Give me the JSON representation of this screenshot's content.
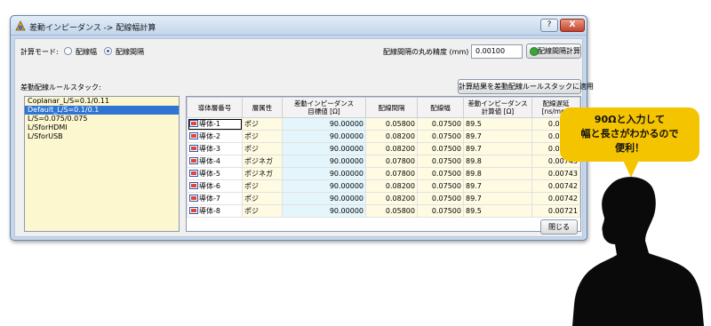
{
  "window": {
    "title": "差動インピーダンス -> 配線幅計算",
    "help_label": "?",
    "close_label": "X"
  },
  "mode": {
    "label": "計算モード:",
    "options": [
      "配線幅",
      "配線間隔"
    ],
    "selected": "配線間隔"
  },
  "precision": {
    "label": "配線間隔の丸め精度 (mm)",
    "value": "0.00100"
  },
  "buttons": {
    "calc": "配線間隔計算",
    "apply": "計算結果を差動配線ルールスタックに適用",
    "close": "閉じる"
  },
  "stack": {
    "label": "差動配線ルールスタック:",
    "items": [
      "Coplanar_L/S=0.1/0.11",
      "Default_L/S=0.1/0.1",
      "L/S=0.075/0.075",
      "L/SforHDMI",
      "L/SforUSB"
    ],
    "selected_index": 1
  },
  "table": {
    "headers": [
      "導体層番号",
      "層属性",
      "差動インピーダンス\n目標値 [Ω]",
      "配線間隔",
      "配線幅",
      "差動インピーダンス\n計算値 [Ω]",
      "配線遅延\n[ns/mm]"
    ],
    "rows": [
      [
        "導体-1",
        "ポジ",
        "90.00000",
        "0.05800",
        "0.07500",
        "89.5",
        "0.00721"
      ],
      [
        "導体-2",
        "ポジ",
        "90.00000",
        "0.08200",
        "0.07500",
        "89.7",
        "0.00742"
      ],
      [
        "導体-3",
        "ポジ",
        "90.00000",
        "0.08200",
        "0.07500",
        "89.7",
        "0.00742"
      ],
      [
        "導体-4",
        "ポジネガ",
        "90.00000",
        "0.07800",
        "0.07500",
        "89.8",
        "0.00743"
      ],
      [
        "導体-5",
        "ポジネガ",
        "90.00000",
        "0.07800",
        "0.07500",
        "89.8",
        "0.00743"
      ],
      [
        "導体-6",
        "ポジ",
        "90.00000",
        "0.08200",
        "0.07500",
        "89.7",
        "0.00742"
      ],
      [
        "導体-7",
        "ポジ",
        "90.00000",
        "0.08200",
        "0.07500",
        "89.7",
        "0.00742"
      ],
      [
        "導体-8",
        "ポジ",
        "90.00000",
        "0.05800",
        "0.07500",
        "89.5",
        "0.00721"
      ]
    ]
  },
  "callout": {
    "lines": [
      "90Ωと入力して",
      "幅と長さがわかるので",
      "便利！"
    ],
    "color": "#f5c400"
  },
  "colors": {
    "selection": "#3175d4",
    "stack_background": "#fdf7cf",
    "target_column": "#e4f6fb"
  }
}
